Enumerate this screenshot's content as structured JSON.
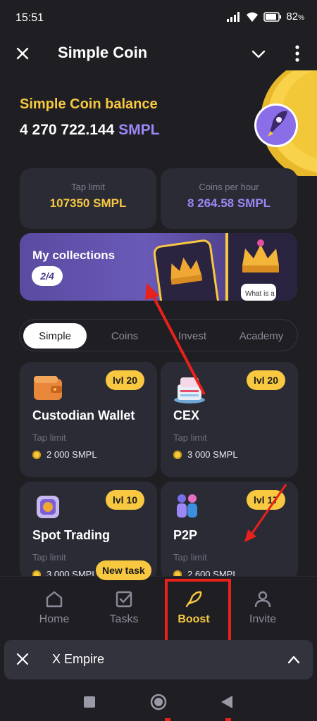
{
  "status": {
    "time": "15:51",
    "battery": "82"
  },
  "header": {
    "title": "Simple Coin"
  },
  "balance": {
    "label": "Simple Coin balance",
    "amount": "4 270 722.144",
    "unit": "SMPL"
  },
  "stats": [
    {
      "label": "Tap limit",
      "value": "107350 SMPL",
      "color": "#f7c840"
    },
    {
      "label": "Coins per hour",
      "value": "8 264.58 SMPL",
      "color": "#9d86f5"
    }
  ],
  "collections": {
    "title": "My collections",
    "progress": "2/4",
    "card_text": "What is a"
  },
  "tabs": [
    "Simple",
    "Coins",
    "Invest",
    "Academy"
  ],
  "cards": [
    {
      "level": "lvl 20",
      "title": "Custodian Wallet",
      "tap_label": "Tap limit",
      "cost": "2 000 SMPL",
      "icon": "wallet-icon"
    },
    {
      "level": "lvl 20",
      "title": "CEX",
      "tap_label": "Tap limit",
      "cost": "3 000 SMPL",
      "icon": "exchange-building-icon"
    },
    {
      "level": "lvl 10",
      "title": "Spot Trading",
      "tap_label": "Tap limit",
      "cost": "3 000 SMPL",
      "icon": "trading-icon"
    },
    {
      "level": "lvl 17",
      "title": "P2P",
      "tap_label": "Tap limit",
      "cost": "2 600 SMPL",
      "icon": "people-icon"
    }
  ],
  "nav": {
    "new_task": "New task",
    "items": [
      "Home",
      "Tasks",
      "Boost",
      "Invite"
    ],
    "active": "Boost"
  },
  "mini_app": {
    "title": "X Empire"
  },
  "colors": {
    "accent": "#f7c840",
    "purple": "#9d86f5",
    "annotation": "#e8211b",
    "background": "#1f1f23"
  }
}
